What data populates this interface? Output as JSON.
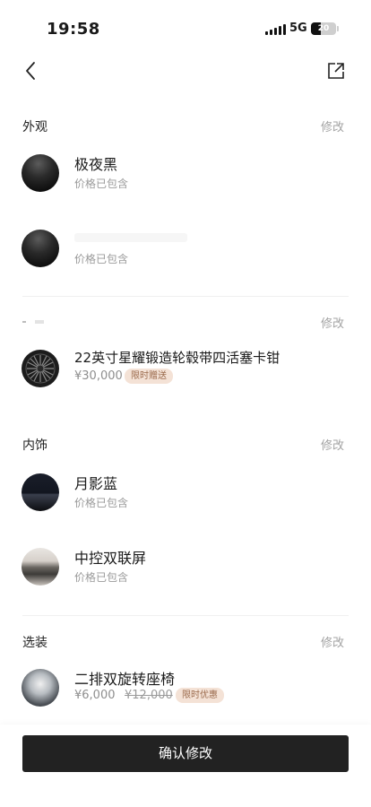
{
  "status_bar": {
    "time": "19:58",
    "network": "5G",
    "battery": "20"
  },
  "nav": {
    "back_icon": "chevron-left-icon",
    "share_icon": "share-icon"
  },
  "edit_label": "修改",
  "sections": {
    "exterior": {
      "title": "外观",
      "items": [
        {
          "name": "极夜黑",
          "sub": "价格已包含"
        },
        {
          "name": "",
          "sub": "价格已包含"
        }
      ]
    },
    "wheels": {
      "title": "",
      "items": [
        {
          "name": "22英寸星耀锻造轮毂带四活塞卡钳",
          "price": "¥30,000",
          "badge": "限时赠送"
        }
      ]
    },
    "interior": {
      "title": "内饰",
      "items": [
        {
          "name": "月影蓝",
          "sub": "价格已包含"
        },
        {
          "name": "中控双联屏",
          "sub": "价格已包含"
        }
      ]
    },
    "options": {
      "title": "选装",
      "items": [
        {
          "name": "二排双旋转座椅",
          "price": "¥6,000",
          "original_price": "¥12,000",
          "badge": "限时优惠"
        }
      ]
    }
  },
  "confirm_button": "确认修改",
  "colors": {
    "badge_bg": "#f4e2d6",
    "badge_text": "#9b6b4d",
    "button_bg": "#222222"
  }
}
